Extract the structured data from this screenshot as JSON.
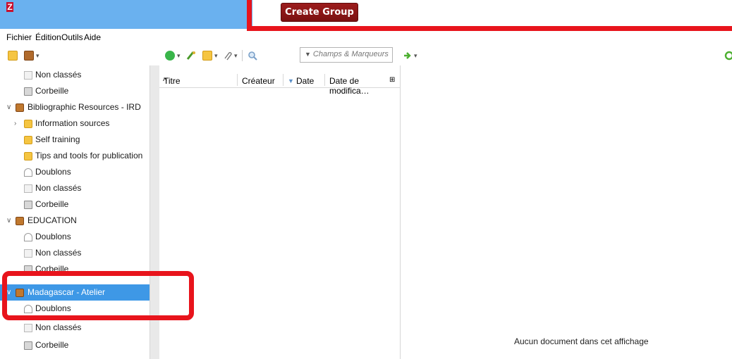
{
  "titlebar": {
    "logo": "Z"
  },
  "create_group_label": "Create Group",
  "menu": {
    "items": [
      "Fichier",
      "Édition",
      "Outils",
      "Aide"
    ]
  },
  "search": {
    "placeholder": "Champs & Marqueurs"
  },
  "columns": {
    "title": "Titre",
    "creator": "Créateur",
    "date": "Date",
    "modified": "Date de modifica…"
  },
  "tree": [
    {
      "label": "Non classés",
      "icon": "doc-icon",
      "level": 2
    },
    {
      "label": "Corbeille",
      "icon": "trash-icon",
      "level": 2
    },
    {
      "label": "Bibliographic Resources - IRD",
      "icon": "library-icon",
      "level": 1,
      "twist": "v"
    },
    {
      "label": "Information sources",
      "icon": "folder-icon",
      "level": 2,
      "twist": ">"
    },
    {
      "label": "Self training",
      "icon": "folder-icon",
      "level": 2
    },
    {
      "label": "Tips and tools for publication",
      "icon": "folder-icon",
      "level": 2
    },
    {
      "label": "Doublons",
      "icon": "duplicates-icon",
      "level": 2
    },
    {
      "label": "Non classés",
      "icon": "doc-icon",
      "level": 2
    },
    {
      "label": "Corbeille",
      "icon": "trash-icon",
      "level": 2
    },
    {
      "label": "EDUCATION",
      "icon": "library-icon",
      "level": 1,
      "twist": "v"
    },
    {
      "label": "Doublons",
      "icon": "duplicates-icon",
      "level": 2
    },
    {
      "label": "Non classés",
      "icon": "doc-icon",
      "level": 2
    },
    {
      "label": "Corbeille",
      "icon": "trash-icon",
      "level": 2
    },
    {
      "label": "Madagascar - Atelier",
      "icon": "library-icon",
      "level": 1,
      "twist": "v",
      "selected": true
    },
    {
      "label": "Doublons",
      "icon": "duplicates-icon",
      "level": 2
    },
    {
      "label": "Non classés",
      "icon": "doc-icon",
      "level": 2
    },
    {
      "label": "Corbeille",
      "icon": "trash-icon",
      "level": 2
    }
  ],
  "empty_message": "Aucun document dans cet affichage",
  "colors": {
    "selection": "#3e98e6",
    "highlight": "#e8141c",
    "titlebar": "#6ab1ef"
  }
}
